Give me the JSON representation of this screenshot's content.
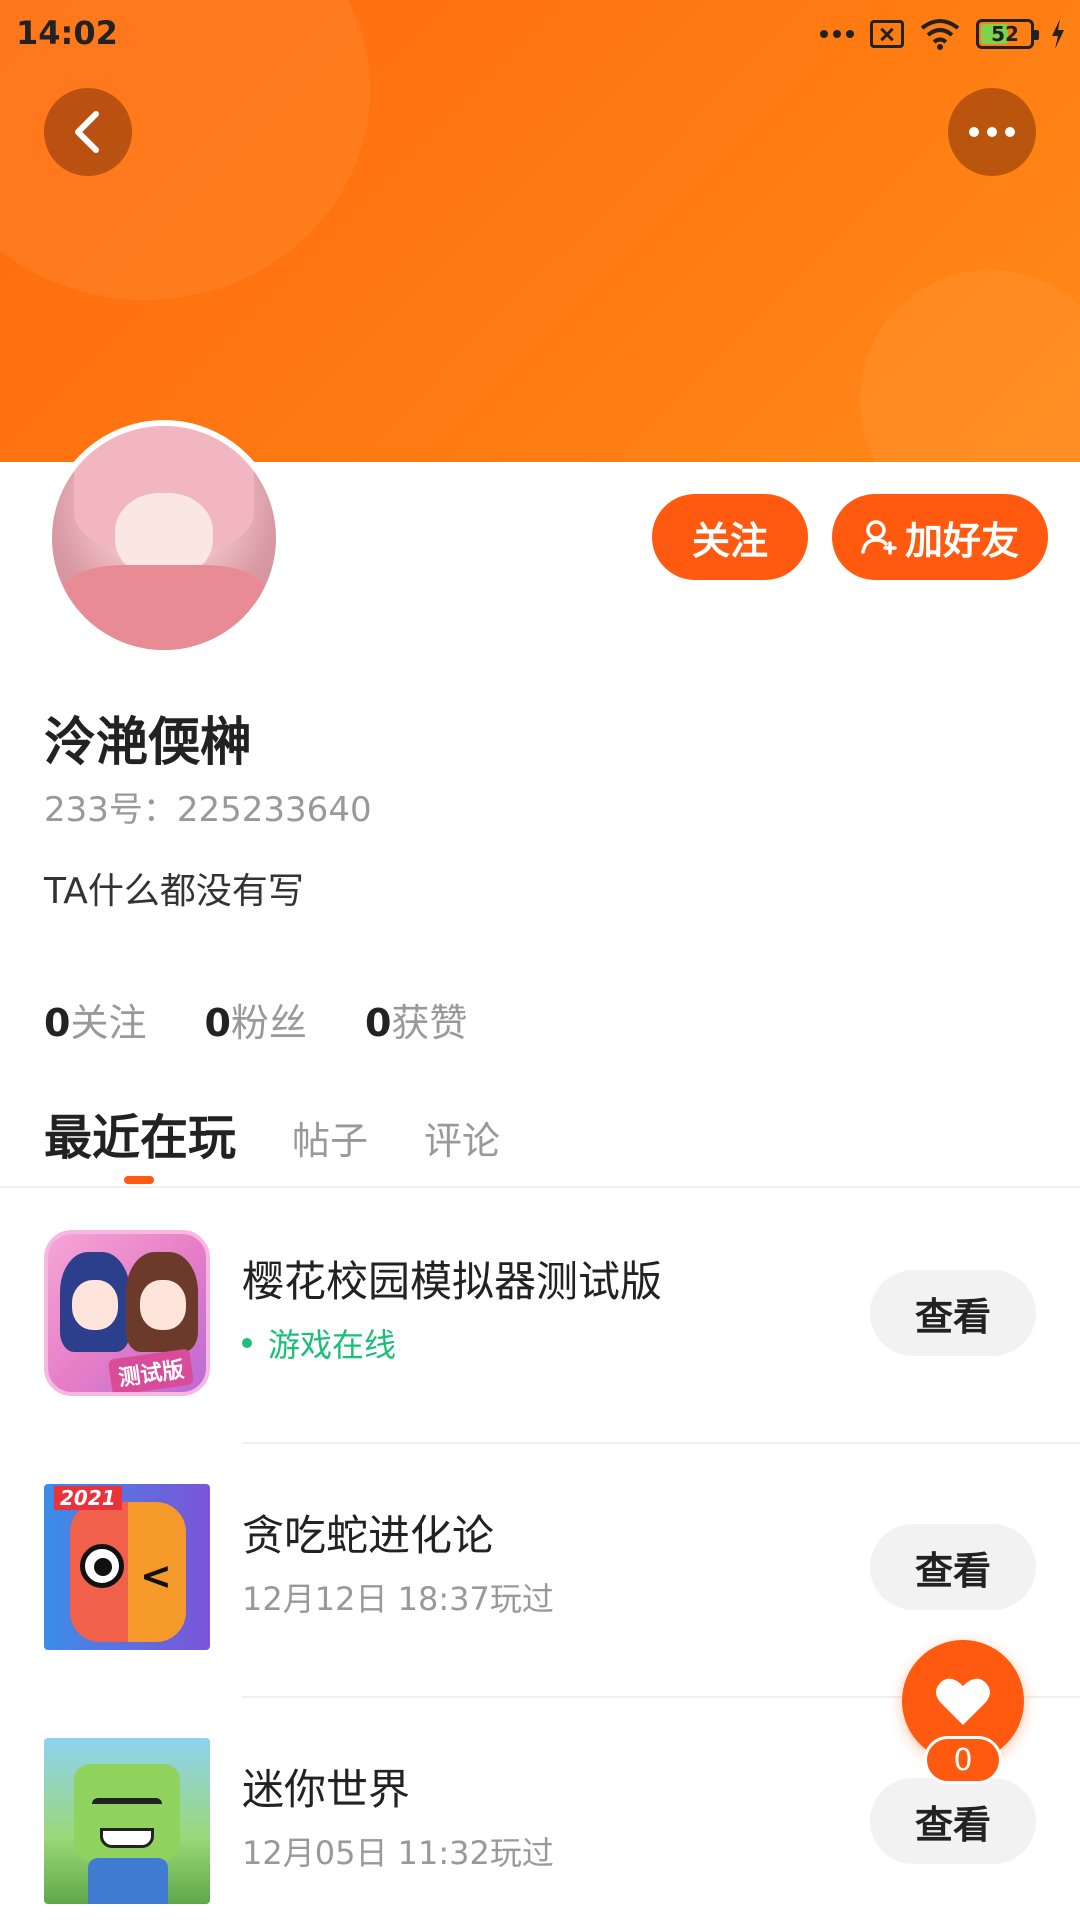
{
  "status_bar": {
    "time": "14:02",
    "battery": "52"
  },
  "header": {
    "back_icon": "chevron-left-icon",
    "more_icon": "more-horizontal-icon"
  },
  "profile": {
    "name": "泠滟偄榊",
    "id_text": "233号：225233640",
    "bio": "TA什么都没有写",
    "follow_label": "关注",
    "add_friend_label": "加好友"
  },
  "stats": [
    {
      "count": "0",
      "label": "关注"
    },
    {
      "count": "0",
      "label": "粉丝"
    },
    {
      "count": "0",
      "label": "获赞"
    }
  ],
  "tabs": [
    {
      "label": "最近在玩",
      "active": true
    },
    {
      "label": "帖子",
      "active": false
    },
    {
      "label": "评论",
      "active": false
    }
  ],
  "games": [
    {
      "title": "樱花校园模拟器测试版",
      "subtitle": "游戏在线",
      "online": true,
      "button": "查看",
      "icon_tag": "测试版"
    },
    {
      "title": "贪吃蛇进化论",
      "subtitle": "12月12日 18:37玩过",
      "online": false,
      "button": "查看",
      "icon_tag": "2021"
    },
    {
      "title": "迷你世界",
      "subtitle": "12月05日 11:32玩过",
      "online": false,
      "button": "查看"
    }
  ],
  "like_fab": {
    "icon": "heart-icon",
    "count": "0"
  },
  "colors": {
    "accent": "#ff5a0f",
    "online": "#1bbf7a",
    "banner": "#ff7a12"
  }
}
